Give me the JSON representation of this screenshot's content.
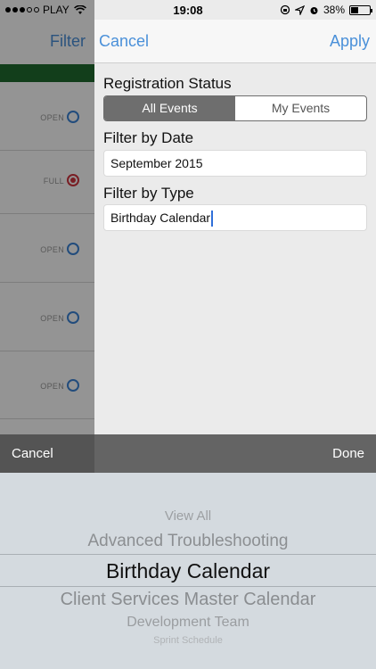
{
  "status_bar": {
    "carrier": "PLAY",
    "time": "19:08",
    "battery": "38%"
  },
  "background": {
    "nav_filter": "Filter",
    "rows": [
      {
        "status": "OPEN",
        "full": false
      },
      {
        "status": "FULL",
        "full": true
      },
      {
        "status": "OPEN",
        "full": false
      },
      {
        "status": "OPEN",
        "full": false
      },
      {
        "status": "OPEN",
        "full": false
      }
    ],
    "partial_status": "OPEN"
  },
  "panel": {
    "cancel_label": "Cancel",
    "apply_label": "Apply",
    "registration_label": "Registration Status",
    "segments": [
      {
        "label": "All Events",
        "active": true
      },
      {
        "label": "My Events",
        "active": false
      }
    ],
    "date_label": "Filter by Date",
    "date_value": "September 2015",
    "type_label": "Filter by Type",
    "type_value": "Birthday Calendar"
  },
  "toolbar": {
    "cancel_label": "Cancel",
    "done_label": "Done"
  },
  "picker": {
    "items": [
      "View All",
      "Advanced Troubleshooting",
      "Birthday Calendar",
      "Client Services Master Calendar",
      "Development Team",
      "Sprint Schedule"
    ],
    "selected_index": 2
  },
  "colors": {
    "accent": "#4a90d9",
    "open": "#3b84d6",
    "full": "#d0343f",
    "header_green": "#1f6b30"
  }
}
